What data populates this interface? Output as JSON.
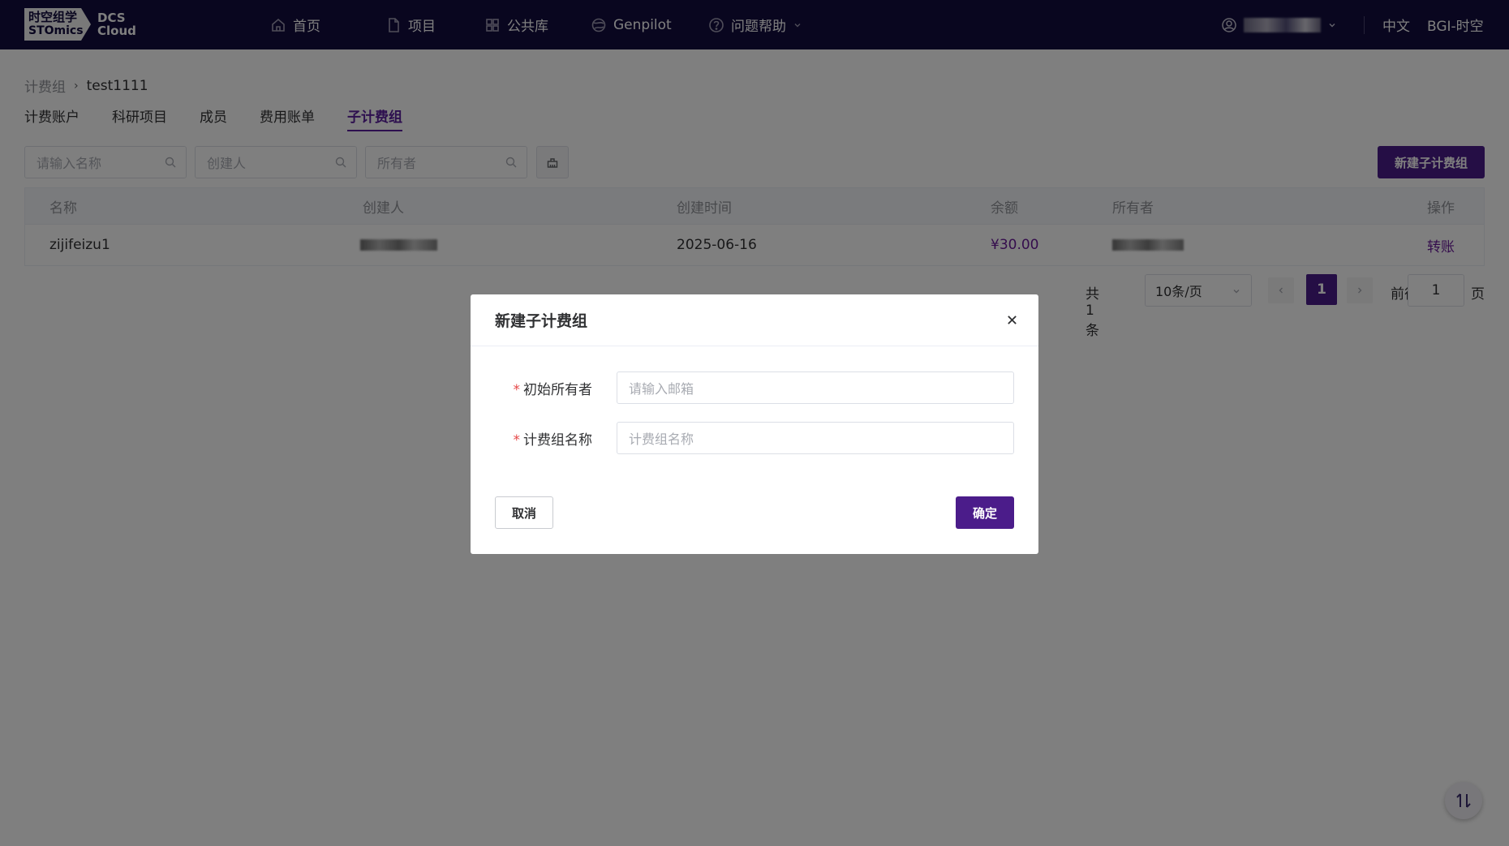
{
  "brand": {
    "logo_cn": "时空组学",
    "logo_en": "STOmics",
    "product_line1": "DCS",
    "product_line2": "Cloud"
  },
  "nav": {
    "items": [
      {
        "label": "首页",
        "icon": "home-icon"
      },
      {
        "label": "项目",
        "icon": "document-icon"
      },
      {
        "label": "公共库",
        "icon": "grid-icon"
      },
      {
        "label": "Genpilot",
        "icon": "globe-icon"
      },
      {
        "label": "问题帮助",
        "icon": "help-circle-icon"
      }
    ],
    "language": "中文",
    "organization": "BGI-时空"
  },
  "breadcrumb": {
    "root": "计费组",
    "current": "test1111"
  },
  "tabs": [
    {
      "label": "计费账户",
      "active": false
    },
    {
      "label": "科研项目",
      "active": false
    },
    {
      "label": "成员",
      "active": false
    },
    {
      "label": "费用账单",
      "active": false
    },
    {
      "label": "子计费组",
      "active": true
    }
  ],
  "filters": {
    "name_placeholder": "请输入名称",
    "creator_placeholder": "创建人",
    "owner_placeholder": "所有者"
  },
  "new_button": "新建子计费组",
  "table": {
    "headers": [
      "名称",
      "创建人",
      "创建时间",
      "余额",
      "所有者",
      "操作"
    ],
    "rows": [
      {
        "name": "zijifeizu1",
        "created": "2025-06-16",
        "balance": "¥30.00",
        "action": "转账"
      }
    ]
  },
  "pagination": {
    "total": "共 1 条",
    "page_size": "10条/页",
    "current_page": "1",
    "goto_label": "前往",
    "goto_value": "1",
    "page_suffix": "页"
  },
  "modal": {
    "title": "新建子计费组",
    "fields": [
      {
        "label": "初始所有者",
        "placeholder": "请输入邮箱"
      },
      {
        "label": "计费组名称",
        "placeholder": "计费组名称"
      }
    ],
    "required_mark": "*",
    "cancel": "取消",
    "confirm": "确定"
  },
  "colors": {
    "nav_bg": "#120c3e",
    "accent": "#4b1c8a",
    "money": "#6a1b9a",
    "required": "#e54848"
  }
}
